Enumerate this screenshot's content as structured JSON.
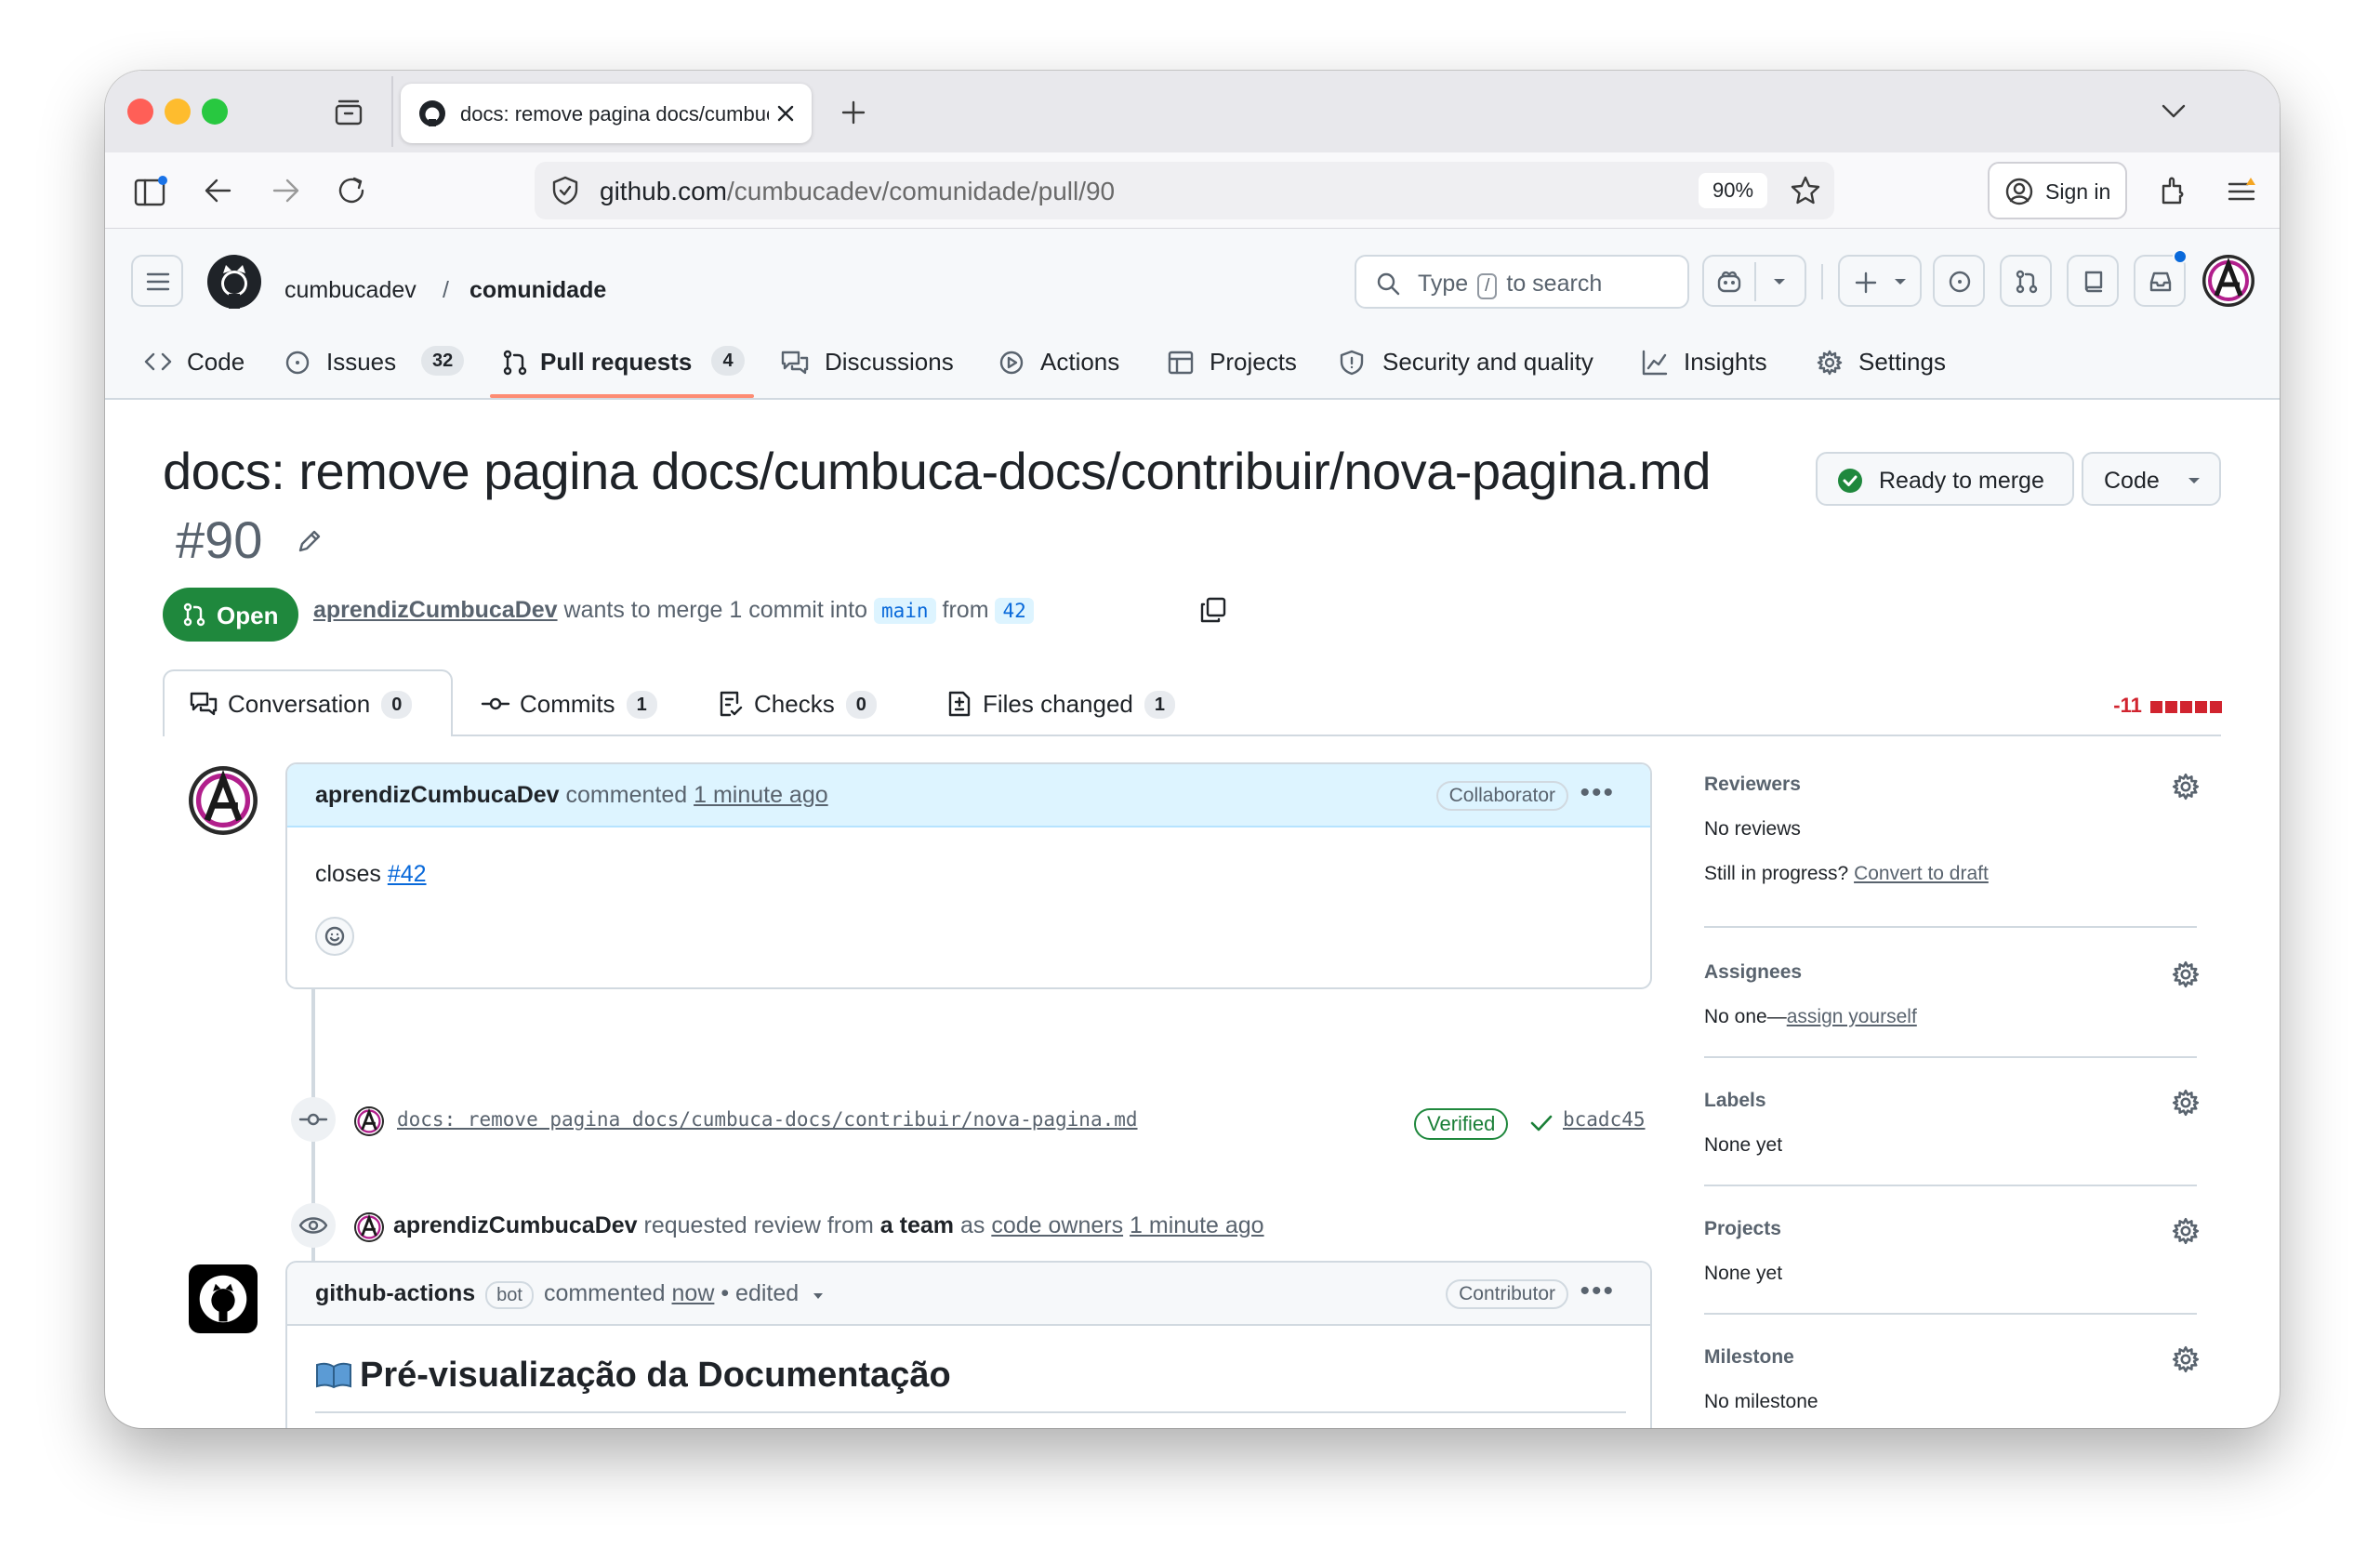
{
  "browser": {
    "tab_title": "docs: remove pagina docs/cumbuca-docs/contribuir/nova-pagina.md",
    "url_domain": "github.com",
    "url_path": "/cumbucadev/comunidade/pull/90",
    "zoom": "90%",
    "sign_in": "Sign in"
  },
  "header": {
    "owner": "cumbucadev",
    "separator": "/",
    "repo": "comunidade",
    "search_type": "Type",
    "search_key": "/",
    "search_rest": "to search"
  },
  "nav": {
    "code": "Code",
    "issues": "Issues",
    "issues_count": "32",
    "pulls": "Pull requests",
    "pulls_count": "4",
    "discussions": "Discussions",
    "actions": "Actions",
    "projects": "Projects",
    "security": "Security and quality",
    "insights": "Insights",
    "settings": "Settings"
  },
  "pr": {
    "title": "docs: remove pagina docs/cumbuca-docs/contribuir/nova-pagina.md",
    "number": "#90",
    "merge_status": "Ready to merge",
    "code_button": "Code",
    "state": "Open",
    "author": "aprendizCumbucaDev",
    "wants_to_merge": "wants to merge 1 commit into",
    "base_branch": "main",
    "from": "from",
    "head_branch": "42"
  },
  "pr_tabs": {
    "conversation": "Conversation",
    "conversation_count": "0",
    "commits": "Commits",
    "commits_count": "1",
    "checks": "Checks",
    "checks_count": "0",
    "files": "Files changed",
    "files_count": "1",
    "diffstat": "-11"
  },
  "comment1": {
    "author": "aprendizCumbucaDev",
    "action": "commented",
    "time": "1 minute ago",
    "role": "Collaborator",
    "body_prefix": "closes",
    "body_link": "#42"
  },
  "commit_event": {
    "message": "docs: remove pagina docs/cumbuca-docs/contribuir/nova-pagina.md",
    "verified": "Verified",
    "sha": "bcadc45"
  },
  "review_event": {
    "author": "aprendizCumbucaDev",
    "text": "requested review from",
    "team": "a team",
    "as": "as",
    "code_owners": "code owners",
    "time": "1 minute ago"
  },
  "comment2": {
    "author": "github-actions",
    "bot": "bot",
    "action": "commented",
    "time": "now",
    "edited": "• edited",
    "role": "Contributor",
    "heading": "Pré-visualização da Documentação"
  },
  "sidebar": {
    "reviewers_title": "Reviewers",
    "reviewers_value": "No reviews",
    "still_in_progress": "Still in progress?",
    "convert_to_draft": "Convert to draft",
    "assignees_title": "Assignees",
    "assignees_value": "No one—",
    "assign_yourself": "assign yourself",
    "labels_title": "Labels",
    "labels_value": "None yet",
    "projects_title": "Projects",
    "projects_value": "None yet",
    "milestone_title": "Milestone",
    "milestone_value": "No milestone"
  },
  "colors": {
    "merge_green": "#1f883d",
    "link_blue": "#0969da",
    "tab_underline": "#fd8c73",
    "deletion_red": "#d1242f"
  }
}
